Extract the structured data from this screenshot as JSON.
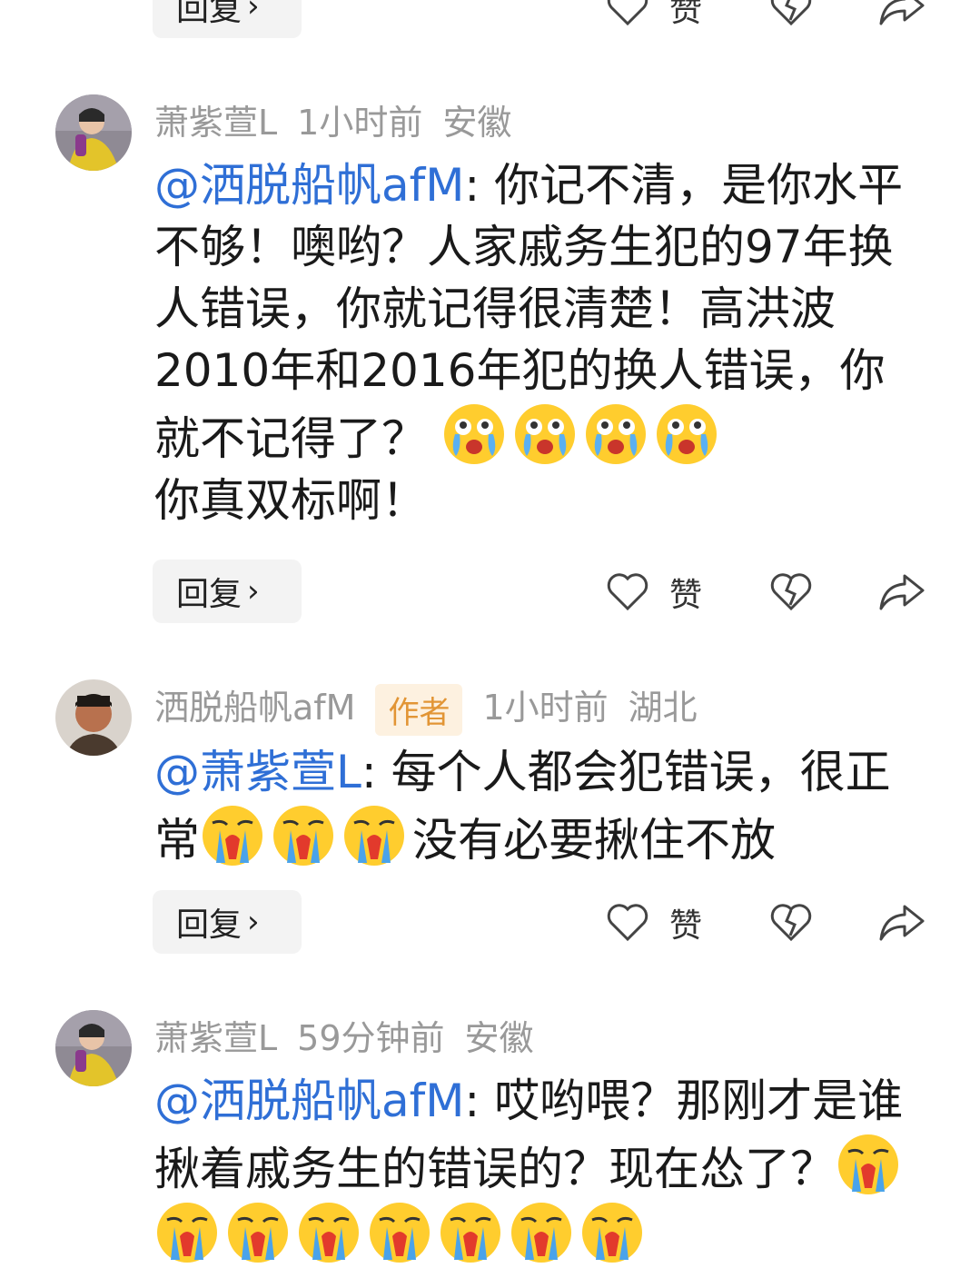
{
  "ui": {
    "reply_label": "回复",
    "like_label": "赞"
  },
  "comments": [
    {
      "user": "萧紫萱L",
      "time": "1小时前",
      "location": "安徽",
      "mention": "@洒脱船帆afM",
      "text_part1": ": 你记不清，是你水平不够！噢哟？人家戚务生犯的97年换人错误，你就记得很清楚！高洪波2010年和2016年犯的换人错误，你就不记得了？",
      "text_part2": "你真双标啊！",
      "emoji_count": 4,
      "emoji_type": "crying-emoji"
    },
    {
      "user": "洒脱船帆afM",
      "badge": "作者",
      "time": "1小时前",
      "location": "湖北",
      "mention": "@萧紫萱L",
      "text_part1": ": 每个人都会犯错误，很正常",
      "text_part2": "没有必要揪住不放",
      "emoji_count": 3,
      "emoji_type": "sobbing-emoji"
    },
    {
      "user": "萧紫萱L",
      "time": "59分钟前",
      "location": "安徽",
      "mention": "@洒脱船帆afM",
      "text_part1": ": 哎哟喂？那刚才是谁揪着戚务生的错误的？现在怂了？",
      "emoji_count": 8,
      "emoji_type": "sobbing-emoji"
    }
  ],
  "colors": {
    "mention": "#2f6fd6",
    "meta": "#999999",
    "badge_bg": "#fdf1e0",
    "badge_text": "#e29535"
  }
}
